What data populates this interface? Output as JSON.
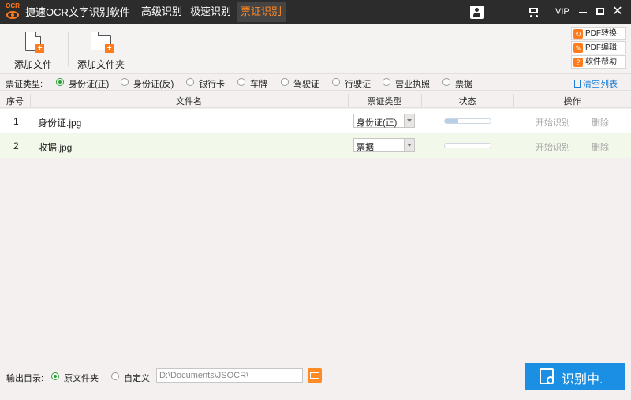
{
  "app": {
    "logo_text": "OCR",
    "title": "捷速OCR文字识别软件",
    "nav_tabs": [
      "高级识别",
      "极速识别",
      "票证识别"
    ],
    "active_tab": "票证识别",
    "vip_label": "VIP",
    "close_glyph": "✕"
  },
  "toolbar": {
    "add_file": "添加文件",
    "add_folder": "添加文件夹",
    "plus_glyph": "+",
    "side_buttons": [
      {
        "label": "PDF转换",
        "icon": "pdf-convert-icon",
        "glyph": "↻"
      },
      {
        "label": "PDF编辑",
        "icon": "pdf-edit-icon",
        "glyph": "✎"
      },
      {
        "label": "软件帮助",
        "icon": "help-icon",
        "glyph": "?"
      }
    ]
  },
  "filter": {
    "label": "票证类型:",
    "options": [
      "身份证(正)",
      "身份证(反)",
      "银行卡",
      "车牌",
      "驾驶证",
      "行驶证",
      "营业执照",
      "票据"
    ],
    "selected": "身份证(正)",
    "clear_list": "清空列表"
  },
  "table": {
    "headers": [
      "序号",
      "文件名",
      "票证类型",
      "状态",
      "操作"
    ],
    "rows": [
      {
        "index": "1",
        "filename": "身份证.jpg",
        "type": "身份证(正)",
        "progress": 0.3,
        "action_start": "开始识别",
        "action_delete": "删除"
      },
      {
        "index": "2",
        "filename": "收据.jpg",
        "type": "票据",
        "progress": 0.0,
        "action_start": "开始识别",
        "action_delete": "删除"
      }
    ]
  },
  "bottom": {
    "output_label": "输出目录:",
    "option_original": "原文件夹",
    "option_custom": "自定义",
    "selected_option": "原文件夹",
    "path_value": "D:\\Documents\\JSOCR\\",
    "recognize_button": "识别中."
  },
  "colors": {
    "accent_orange": "#ff7b1c",
    "primary_blue": "#1a8fe3",
    "radio_green": "#2aa136",
    "titlebar": "#2c2c2c"
  }
}
